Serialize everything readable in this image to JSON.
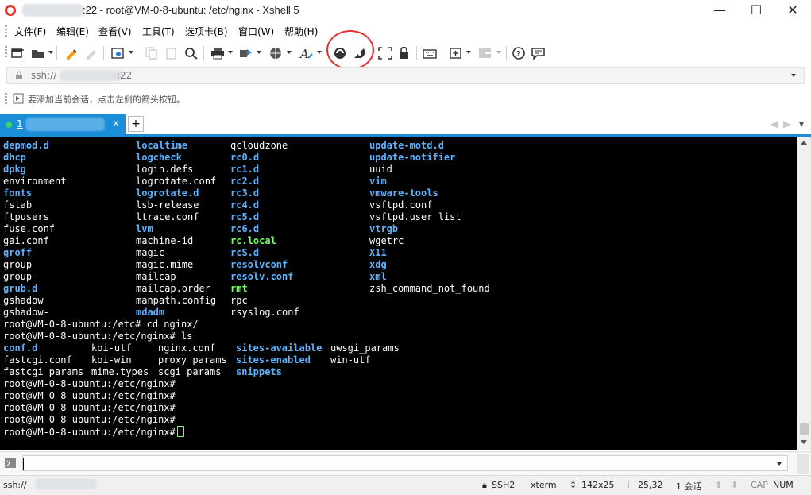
{
  "window": {
    "title": ":22 - root@VM-0-8-ubuntu: /etc/nginx - Xshell 5",
    "controls": {
      "minimize": "—",
      "maximize": "☐",
      "close": "✕"
    }
  },
  "menu": [
    "文件(F)",
    "编辑(E)",
    "查看(V)",
    "工具(T)",
    "选项卡(B)",
    "窗口(W)",
    "帮助(H)"
  ],
  "address": {
    "value": "ssh://",
    "port": ":22"
  },
  "hint": {
    "text": "要添加当前会话，点击左侧的箭头按钮。"
  },
  "tabs": {
    "active_label": "1",
    "close": "×",
    "add": "+"
  },
  "terminal": {
    "listing_etc": [
      [
        [
          "depmod.d",
          "b"
        ],
        [
          "localtime",
          "b"
        ],
        [
          "qcloudzone",
          "w"
        ],
        [
          "update-motd.d",
          "b"
        ]
      ],
      [
        [
          "dhcp",
          "b"
        ],
        [
          "logcheck",
          "b"
        ],
        [
          "rc0.d",
          "b"
        ],
        [
          "update-notifier",
          "b"
        ]
      ],
      [
        [
          "dpkg",
          "b"
        ],
        [
          "login.defs",
          "w"
        ],
        [
          "rc1.d",
          "b"
        ],
        [
          "uuid",
          "w"
        ]
      ],
      [
        [
          "environment",
          "w"
        ],
        [
          "logrotate.conf",
          "w"
        ],
        [
          "rc2.d",
          "b"
        ],
        [
          "vim",
          "b"
        ]
      ],
      [
        [
          "fonts",
          "b"
        ],
        [
          "logrotate.d",
          "b"
        ],
        [
          "rc3.d",
          "b"
        ],
        [
          "vmware-tools",
          "b"
        ]
      ],
      [
        [
          "fstab",
          "w"
        ],
        [
          "lsb-release",
          "w"
        ],
        [
          "rc4.d",
          "b"
        ],
        [
          "vsftpd.conf",
          "w"
        ]
      ],
      [
        [
          "ftpusers",
          "w"
        ],
        [
          "ltrace.conf",
          "w"
        ],
        [
          "rc5.d",
          "b"
        ],
        [
          "vsftpd.user_list",
          "w"
        ]
      ],
      [
        [
          "fuse.conf",
          "w"
        ],
        [
          "lvm",
          "b"
        ],
        [
          "rc6.d",
          "b"
        ],
        [
          "vtrgb",
          "b"
        ]
      ],
      [
        [
          "gai.conf",
          "w"
        ],
        [
          "machine-id",
          "w"
        ],
        [
          "rc.local",
          "g"
        ],
        [
          "wgetrc",
          "w"
        ]
      ],
      [
        [
          "groff",
          "b"
        ],
        [
          "magic",
          "w"
        ],
        [
          "rcS.d",
          "b"
        ],
        [
          "X11",
          "b"
        ]
      ],
      [
        [
          "group",
          "w"
        ],
        [
          "magic.mime",
          "w"
        ],
        [
          "resolvconf",
          "b"
        ],
        [
          "xdg",
          "b"
        ]
      ],
      [
        [
          "group-",
          "w"
        ],
        [
          "mailcap",
          "w"
        ],
        [
          "resolv.conf",
          "b"
        ],
        [
          "xml",
          "b"
        ]
      ],
      [
        [
          "grub.d",
          "b"
        ],
        [
          "mailcap.order",
          "w"
        ],
        [
          "rmt",
          "g"
        ],
        [
          "zsh_command_not_found",
          "w"
        ]
      ],
      [
        [
          "gshadow",
          "w"
        ],
        [
          "manpath.config",
          "w"
        ],
        [
          "rpc",
          "w"
        ],
        [
          "",
          ""
        ]
      ],
      [
        [
          "gshadow-",
          "w"
        ],
        [
          "mdadm",
          "b"
        ],
        [
          "rsyslog.conf",
          "w"
        ],
        [
          "",
          ""
        ]
      ]
    ],
    "cmd1": "root@VM-0-8-ubuntu:/etc# cd nginx/",
    "cmd2": "root@VM-0-8-ubuntu:/etc/nginx# ls",
    "listing_nginx": [
      [
        [
          "conf.d",
          "b"
        ],
        [
          "koi-utf",
          "w"
        ],
        [
          "nginx.conf",
          "w"
        ],
        [
          "sites-available",
          "b"
        ],
        [
          "uwsgi_params",
          "w"
        ]
      ],
      [
        [
          "fastcgi.conf",
          "w"
        ],
        [
          "koi-win",
          "w"
        ],
        [
          "proxy_params",
          "w"
        ],
        [
          "sites-enabled",
          "b"
        ],
        [
          "win-utf",
          "w"
        ]
      ],
      [
        [
          "fastcgi_params",
          "w"
        ],
        [
          "mime.types",
          "w"
        ],
        [
          "scgi_params",
          "w"
        ],
        [
          "snippets",
          "b"
        ],
        [
          "",
          ""
        ]
      ]
    ],
    "prompts": [
      "root@VM-0-8-ubuntu:/etc/nginx#",
      "root@VM-0-8-ubuntu:/etc/nginx#",
      "root@VM-0-8-ubuntu:/etc/nginx#",
      "root@VM-0-8-ubuntu:/etc/nginx#",
      "root@VM-0-8-ubuntu:/etc/nginx#"
    ],
    "colors": {
      "background": "#000000",
      "text": "#ffffff",
      "directory": "#5cb3ff",
      "executable": "#73ff63"
    }
  },
  "status": {
    "connection": "ssh://",
    "protocol": "SSH2",
    "terminal_type": "xterm",
    "size": "142x25",
    "cursor_pos": "25,32",
    "sessions": "1 会话",
    "caps": "CAP",
    "num": "NUM"
  },
  "icons": [
    "new-session-icon",
    "open-folder-icon",
    "reconnect-icon",
    "disconnect-icon",
    "properties-icon",
    "copy-icon",
    "paste-icon",
    "find-icon",
    "print-icon",
    "transfer-icon",
    "globe-icon",
    "font-icon",
    "xmanager-icon",
    "xftp-icon",
    "fullscreen-icon",
    "lock-icon",
    "keyboard-icon",
    "new-tab-icon",
    "layout-icon",
    "help-icon",
    "chat-icon"
  ]
}
